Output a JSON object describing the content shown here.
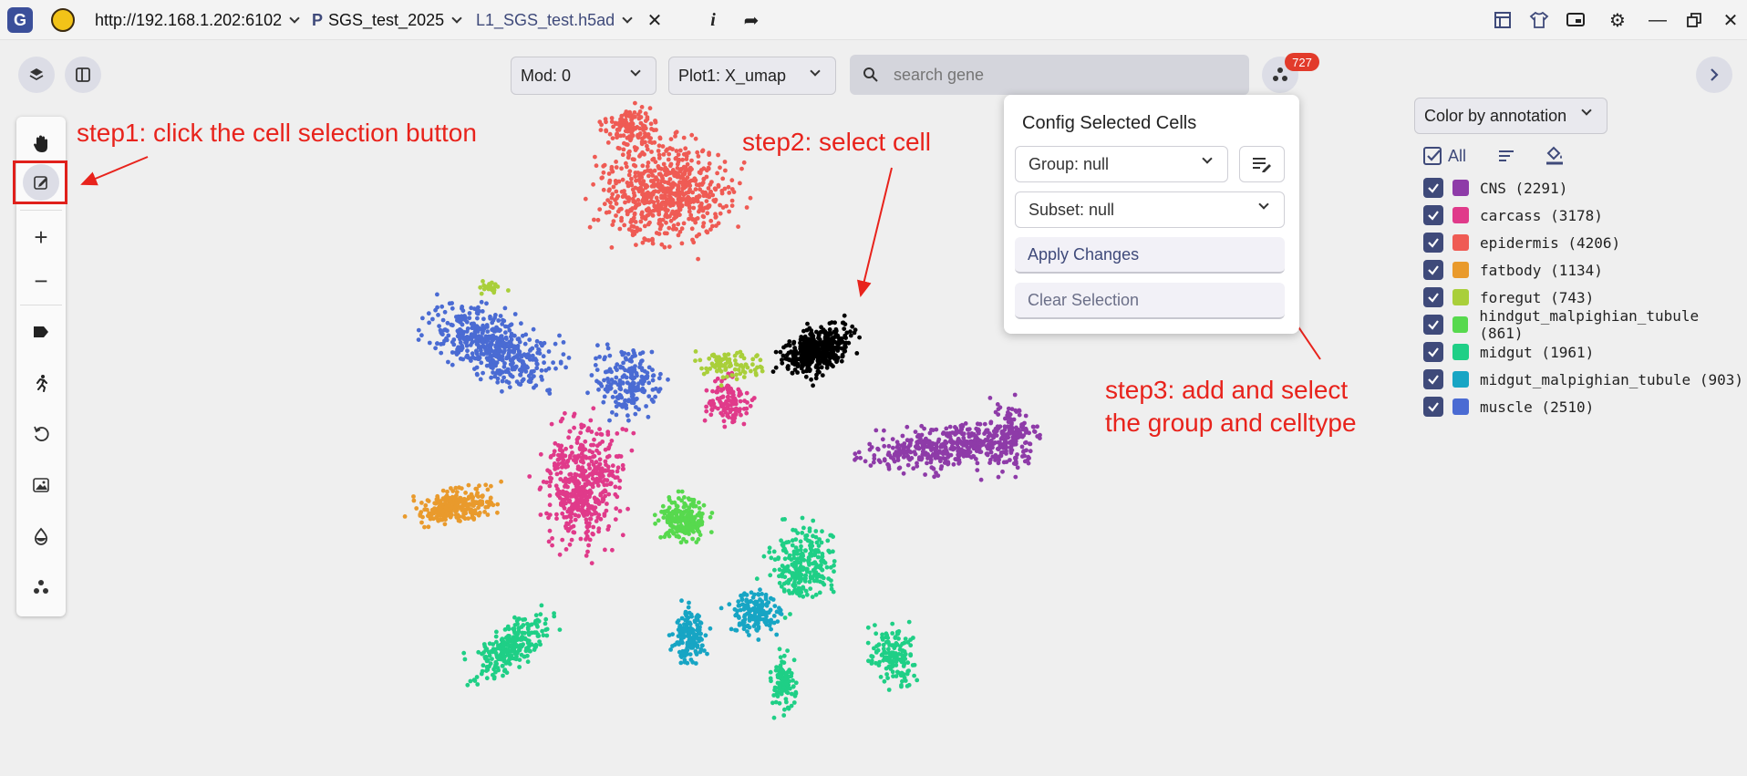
{
  "titlebar": {
    "url": "http://192.168.1.202:6102",
    "project": "SGS_test_2025",
    "project_prefix": "P",
    "file": "L1_SGS_test.h5ad"
  },
  "controls": {
    "mod_label": "Mod: 0",
    "plot_label": "Plot1: X_umap",
    "search_placeholder": "search gene",
    "badge_count": "727"
  },
  "config_popup": {
    "title": "Config Selected Cells",
    "group_label": "Group: null",
    "subset_label": "Subset: null",
    "apply_label": "Apply Changes",
    "clear_label": "Clear Selection"
  },
  "legend": {
    "color_by": "Color by annotation",
    "all_label": "All",
    "items": [
      {
        "label": "CNS (2291)",
        "color": "#8e3ba8"
      },
      {
        "label": "carcass (3178)",
        "color": "#e03a8a"
      },
      {
        "label": "epidermis (4206)",
        "color": "#ef5b54"
      },
      {
        "label": "fatbody (1134)",
        "color": "#e99a2c"
      },
      {
        "label": "foregut (743)",
        "color": "#a9cf3a"
      },
      {
        "label": "hindgut_malpighian_tubule (861)",
        "color": "#57d94e"
      },
      {
        "label": "midgut (1961)",
        "color": "#1fcf86"
      },
      {
        "label": "midgut_malpighian_tubule (903)",
        "color": "#17a5c4"
      },
      {
        "label": "muscle (2510)",
        "color": "#4a6bd3"
      }
    ]
  },
  "annotations": {
    "step1": "step1: click the cell selection button",
    "step2": "step2: select cell",
    "step3_line1": "step3: add and select",
    "step3_line2": "the group and celltype"
  },
  "colors": {
    "accent": "#3f4a7a",
    "annotation_red": "#e8231c",
    "selection": "#000000"
  }
}
